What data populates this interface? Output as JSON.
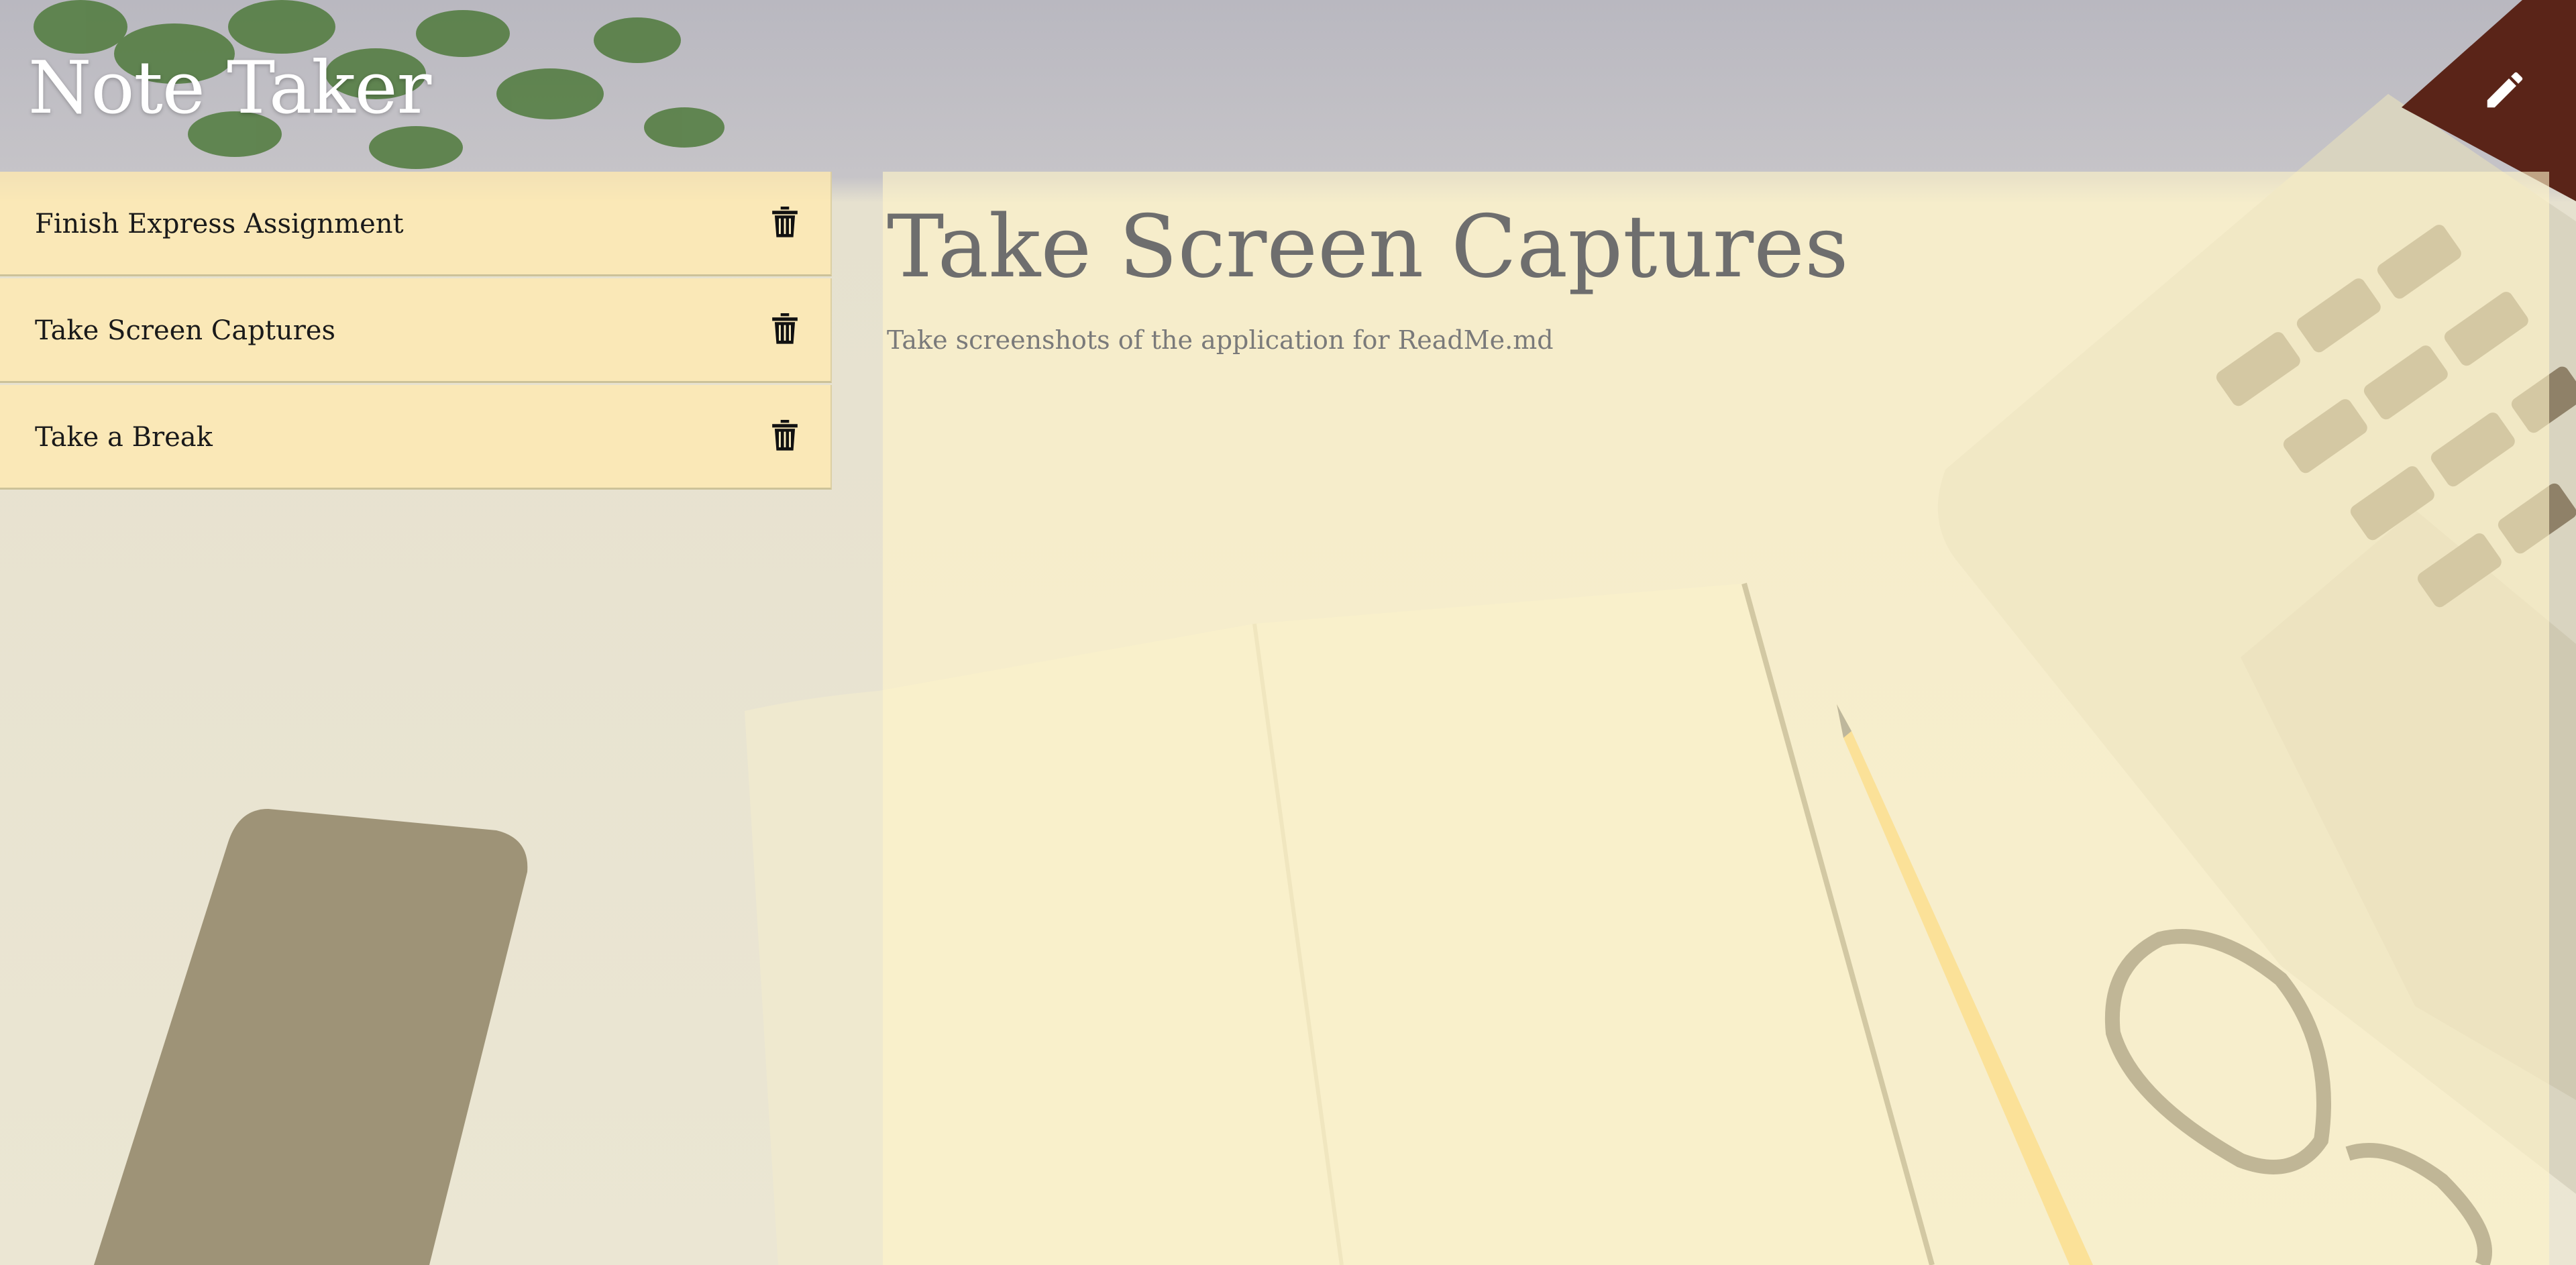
{
  "app": {
    "title": "Note Taker",
    "new_note_icon": "pencil-icon"
  },
  "sidebar": {
    "notes": [
      {
        "title": "Finish Express Assignment",
        "delete_icon": "trash-icon"
      },
      {
        "title": "Take Screen Captures",
        "delete_icon": "trash-icon"
      },
      {
        "title": "Take a Break",
        "delete_icon": "trash-icon"
      }
    ]
  },
  "editor": {
    "title": "Take Screen Captures",
    "text": "Take screenshots of the application for ReadMe.md"
  },
  "colors": {
    "list_item_bg": "#ffeab0",
    "editor_bg": "#fff4c8",
    "title_text": "#ffffff",
    "note_title_text": "#6e6e6e"
  }
}
